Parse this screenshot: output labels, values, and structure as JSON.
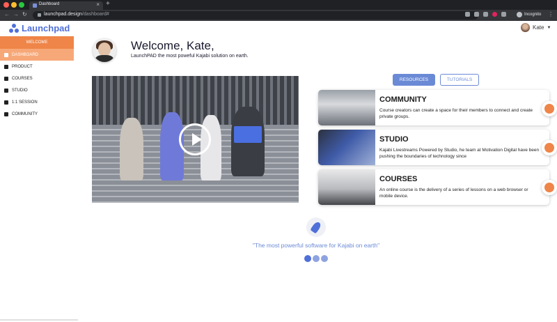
{
  "browser": {
    "tab_title": "Dashboard",
    "url_host": "launchpad.design",
    "url_path": "/dashboard#",
    "profile_label": "Incognito"
  },
  "app": {
    "brand": "Launchpad",
    "user_name": "Kate"
  },
  "sidebar": {
    "welcome_label": "WELCOME",
    "items": [
      {
        "label": "DASHBOARD",
        "icon": "home-icon",
        "active": true
      },
      {
        "label": "PRODUCT",
        "icon": "box-icon",
        "active": false
      },
      {
        "label": "COURSES",
        "icon": "folder-icon",
        "active": false
      },
      {
        "label": "STUDIO",
        "icon": "video-camera-icon",
        "active": false
      },
      {
        "label": "1:1 SESSION",
        "icon": "phone-icon",
        "active": false
      },
      {
        "label": "COMMUNITY",
        "icon": "chat-bubbles-icon",
        "active": false
      }
    ]
  },
  "welcome": {
    "title": "Welcome, Kate,",
    "subtitle": "LaunchPAD the most poweful Kajabi solution on earth."
  },
  "tabs": {
    "resources": "RESOURCES",
    "tutorials": "TUTORIALS"
  },
  "cards": [
    {
      "title": "COMMUNITY",
      "description": "Course creators can create a space for their members to connect and create private groups.",
      "side_icon": "people-icon"
    },
    {
      "title": "STUDIO",
      "description": "Kajabi Livestreams Powered by Studio, he team at Motivation Digital have been pushing the boundaries of technology since",
      "side_icon": "headset-icon"
    },
    {
      "title": "COURSES",
      "description": "An online course is the delivery of a series of lessons on a web browser or mobile device.",
      "side_icon": "book-icon"
    }
  ],
  "footer": {
    "tagline": "\"The most powerful software for Kajabi on earth\"",
    "carousel_dots": 3,
    "active_dot": 0
  },
  "colors": {
    "accent_orange": "#ef8548",
    "accent_blue": "#4f6fd9",
    "tab_blue": "#6b8ad6"
  }
}
